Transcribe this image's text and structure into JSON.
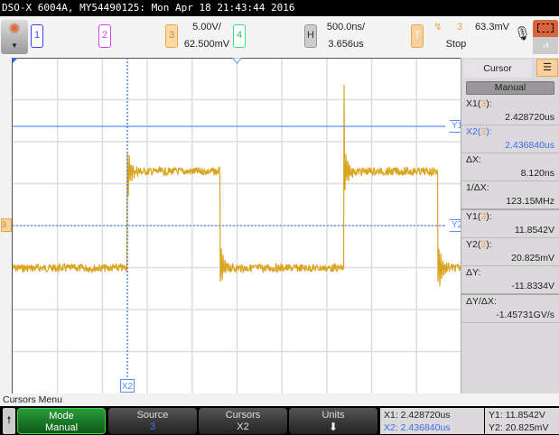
{
  "title": "DSO-X 6004A, MY54490125: Mon Apr 18 21:43:44 2016",
  "toolbar": {
    "ch1": "1",
    "ch2": "2",
    "ch3": "3",
    "ch4": "4",
    "ch3_scale": "5.00V/",
    "ch3_offset": "62.500mV",
    "h_label": "H",
    "h_scale": "500.0ns/",
    "h_delay": "3.656us",
    "t_label": "T",
    "trig_source": "3",
    "trig_level": "63.3mV",
    "trig_status": "Stop",
    "colors": {
      "ch1": "#4040ff",
      "ch2": "#e040e0",
      "ch3": "#e8a84a",
      "ch4": "#40e080",
      "accent": "#d8663a"
    }
  },
  "plot": {
    "y1_label": "Y1",
    "y2_label": "Y2",
    "x2_label": "X2",
    "ch3_marker": "3"
  },
  "side": {
    "tab": "Cursor",
    "mode": "Manual",
    "items": [
      {
        "label": "X1(",
        "src": "3",
        "end": "):",
        "value": "2.428720us"
      },
      {
        "label": "X2(",
        "src": "3",
        "end": "):",
        "value": "2.436840us"
      },
      {
        "label": "ΔX:",
        "value": "8.120ns"
      },
      {
        "label": "1/ΔX:",
        "value": "123.15MHz"
      },
      {
        "label": "Y1(",
        "src": "3",
        "end": "):",
        "value": "11.8542V"
      },
      {
        "label": "Y2(",
        "src": "3",
        "end": "):",
        "value": "20.825mV"
      },
      {
        "label": "ΔY:",
        "value": "-11.8334V"
      },
      {
        "label": "ΔY/ΔX:",
        "value": "-1.45731GV/s"
      }
    ]
  },
  "menu": {
    "title": "Cursors Menu",
    "softkeys": [
      {
        "label": "Mode",
        "value": "Manual"
      },
      {
        "label": "Source",
        "value": "3"
      },
      {
        "label": "Cursors",
        "value": "X2"
      },
      {
        "label": "Units",
        "value": ""
      }
    ],
    "readout": {
      "x1": "X1: 2.428720us",
      "x2": "X2: 2.436840us",
      "y1": "Y1: 11.8542V",
      "y2": "Y2: 20.825mV"
    }
  }
}
